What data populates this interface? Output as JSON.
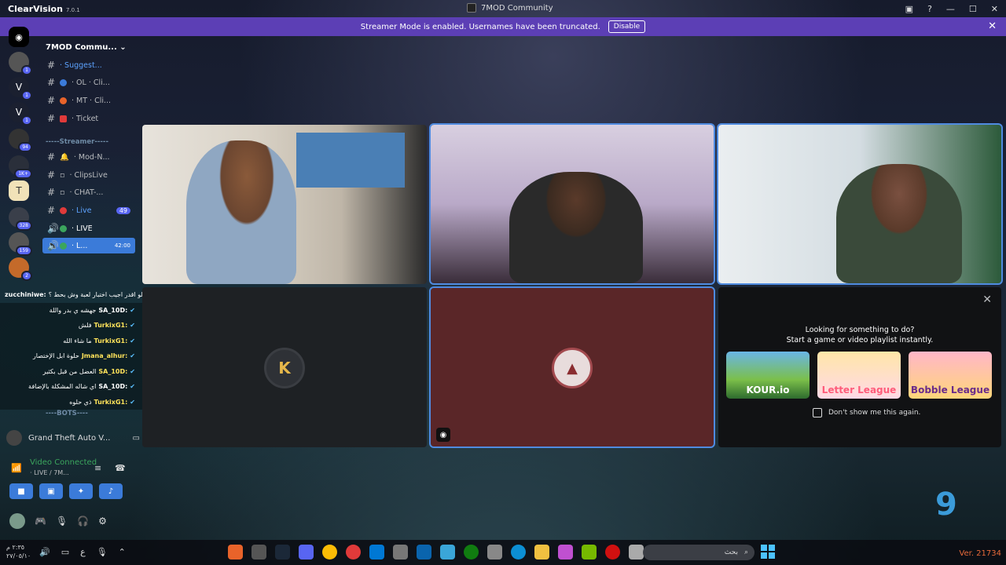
{
  "window": {
    "app": "ClearVision",
    "version": "7.0.1",
    "title": "7MOD Community"
  },
  "banner": {
    "text": "Streamer Mode is enabled. Usernames have been truncated.",
    "button": "Disable"
  },
  "guilds": [
    {
      "badge": "1"
    },
    {
      "badge": "1"
    },
    {
      "badge": "1"
    },
    {
      "badge": "94"
    },
    {
      "badge": "1K+"
    },
    {
      "badge": ""
    },
    {
      "badge": "328"
    },
    {
      "badge": "159"
    },
    {
      "badge": "2"
    }
  ],
  "server": {
    "name": "7MOD Commu..."
  },
  "channels": [
    {
      "label": "· Suggest...",
      "prefix": "#"
    },
    {
      "label": "· OL · Cli...",
      "prefix": "#"
    },
    {
      "label": "· MT · Cli...",
      "prefix": "#"
    },
    {
      "label": "· Ticket",
      "prefix": "#"
    },
    {
      "label": "· Mod-N...",
      "prefix": "#"
    },
    {
      "label": "· ClipsLive",
      "prefix": "#"
    },
    {
      "label": "· CHAT-...",
      "prefix": "#"
    },
    {
      "label": "· Live",
      "prefix": "#",
      "badge": "49"
    },
    {
      "label": "· LIVE",
      "prefix": "🔊"
    },
    {
      "label": "· L...",
      "prefix": "🔊",
      "time": "42:00"
    }
  ],
  "categories": {
    "streamer": "-----Streamer-----",
    "bots": "----BOTS----"
  },
  "chat": [
    {
      "name": "zucchiniwe:",
      "msg": "تدري لو اقدر اجيب اختبار لعبة وش بحط ؟"
    },
    {
      "name": "SA_10D:",
      "msg": "جهشه ي بدر واللة"
    },
    {
      "name": "TurkixG1:",
      "msg": "فلش"
    },
    {
      "name": "TurkixG1:",
      "msg": "ما شاء الله"
    },
    {
      "name": "Jmana_alhur:",
      "msg": "حلوة ابل الإختصار"
    },
    {
      "name": "SA_10D:",
      "msg": "العضل من قبل بكثير"
    },
    {
      "name": "SA_10D:",
      "msg": "اي شاله المشكلة بالإضافة"
    },
    {
      "name": "TurkixG1:",
      "msg": "ذي حلوه"
    }
  ],
  "game": {
    "name": "Grand Theft Auto V..."
  },
  "voice": {
    "status": "Video Connected",
    "channel": "· LIVE / 7M..."
  },
  "activity": {
    "line1": "Looking for something to do?",
    "line2": "Start a game or video playlist instantly.",
    "cards": [
      "KOUR.io",
      "Letter League",
      "Bobble League"
    ],
    "checkbox": "Don't show me this again."
  },
  "taskbar": {
    "time": "٢:٣٥ م",
    "date": "٢٧/٠٥/١٠",
    "search": "بحث",
    "version": "Ver. 21734"
  },
  "colors": {
    "accent": "#5865f2",
    "banner": "#5c3fb5",
    "speaking": "#4f8be0",
    "online": "#3ba55d"
  }
}
